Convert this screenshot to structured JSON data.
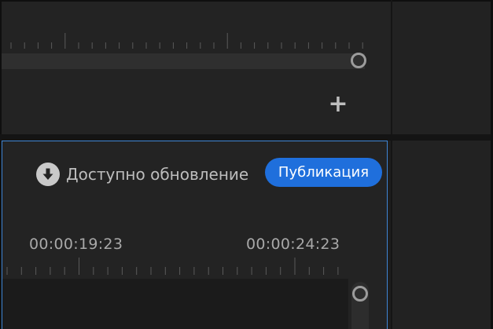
{
  "colors": {
    "accent": "#1f6fdc",
    "panel_border_active": "#3f86d6",
    "background": "#232323"
  },
  "top_panel": {
    "add_icon": "plus-icon",
    "add_symbol": "+"
  },
  "bottom_panel": {
    "update": {
      "icon": "download-icon",
      "text": "Доступно обновление"
    },
    "publish_button": "Публикация",
    "timecodes": [
      "00:00:19:23",
      "00:00:24:23"
    ]
  }
}
